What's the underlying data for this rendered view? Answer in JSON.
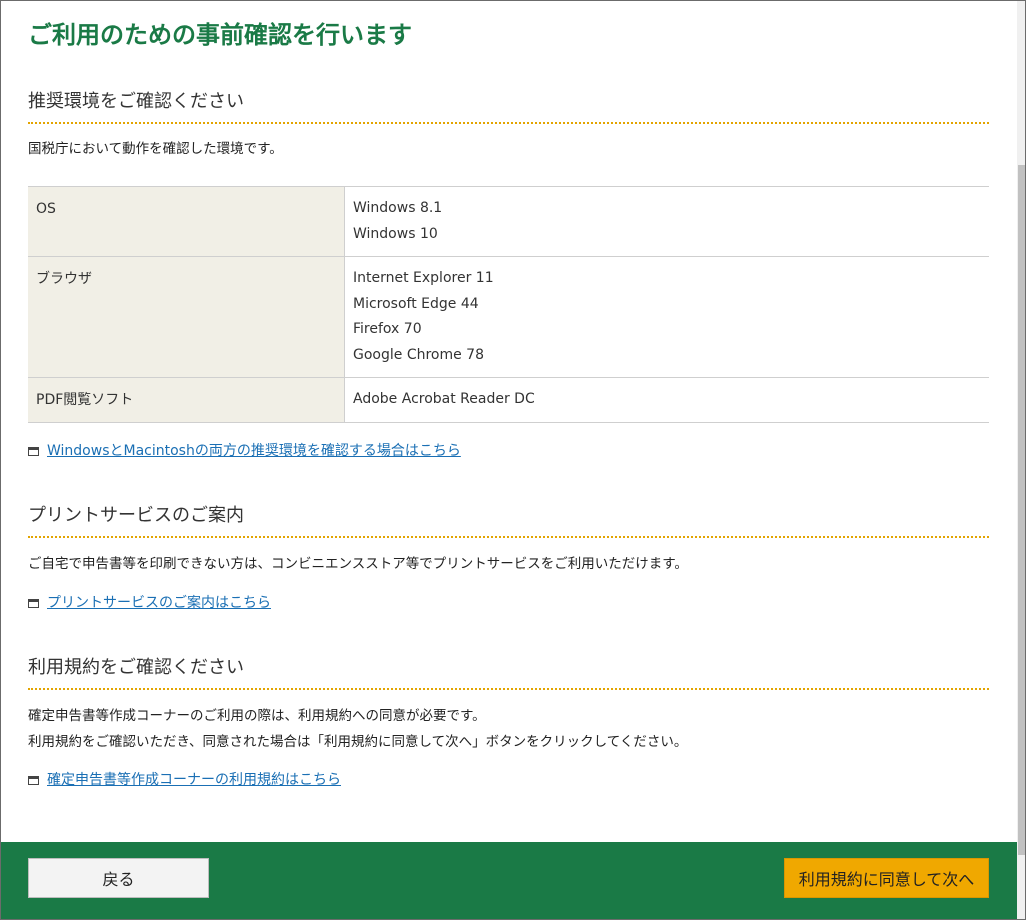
{
  "page": {
    "title": "ご利用のための事前確認を行います"
  },
  "env_section": {
    "heading": "推奨環境をご確認ください",
    "description": "国税庁において動作を確認した環境です。",
    "rows": [
      {
        "key": "OS",
        "values": [
          "Windows 8.1",
          "Windows 10"
        ]
      },
      {
        "key": "ブラウザ",
        "values": [
          "Internet Explorer 11",
          "Microsoft Edge 44",
          "Firefox 70",
          "Google Chrome 78"
        ]
      },
      {
        "key": "PDF閲覧ソフト",
        "values": [
          "Adobe Acrobat Reader DC"
        ]
      }
    ],
    "link": "WindowsとMacintoshの両方の推奨環境を確認する場合はこちら"
  },
  "print_section": {
    "heading": "プリントサービスのご案内",
    "description": "ご自宅で申告書等を印刷できない方は、コンビニエンスストア等でプリントサービスをご利用いただけます。",
    "link": "プリントサービスのご案内はこちら"
  },
  "terms_section": {
    "heading": "利用規約をご確認ください",
    "description_1": "確定申告書等作成コーナーのご利用の際は、利用規約への同意が必要です。",
    "description_2": "利用規約をご確認いただき、同意された場合は「利用規約に同意して次へ」ボタンをクリックしてください。",
    "link": "確定申告書等作成コーナーの利用規約はこちら"
  },
  "footer": {
    "back_label": "戻る",
    "next_label": "利用規約に同意して次へ"
  },
  "colors": {
    "title_green": "#1a7a46",
    "footer_green": "#1a7a46",
    "accent_orange": "#f0a800",
    "link_blue": "#1a6fb4",
    "dotted_rule": "#e3a400"
  },
  "icons": {
    "external_window": "new-window-icon"
  }
}
